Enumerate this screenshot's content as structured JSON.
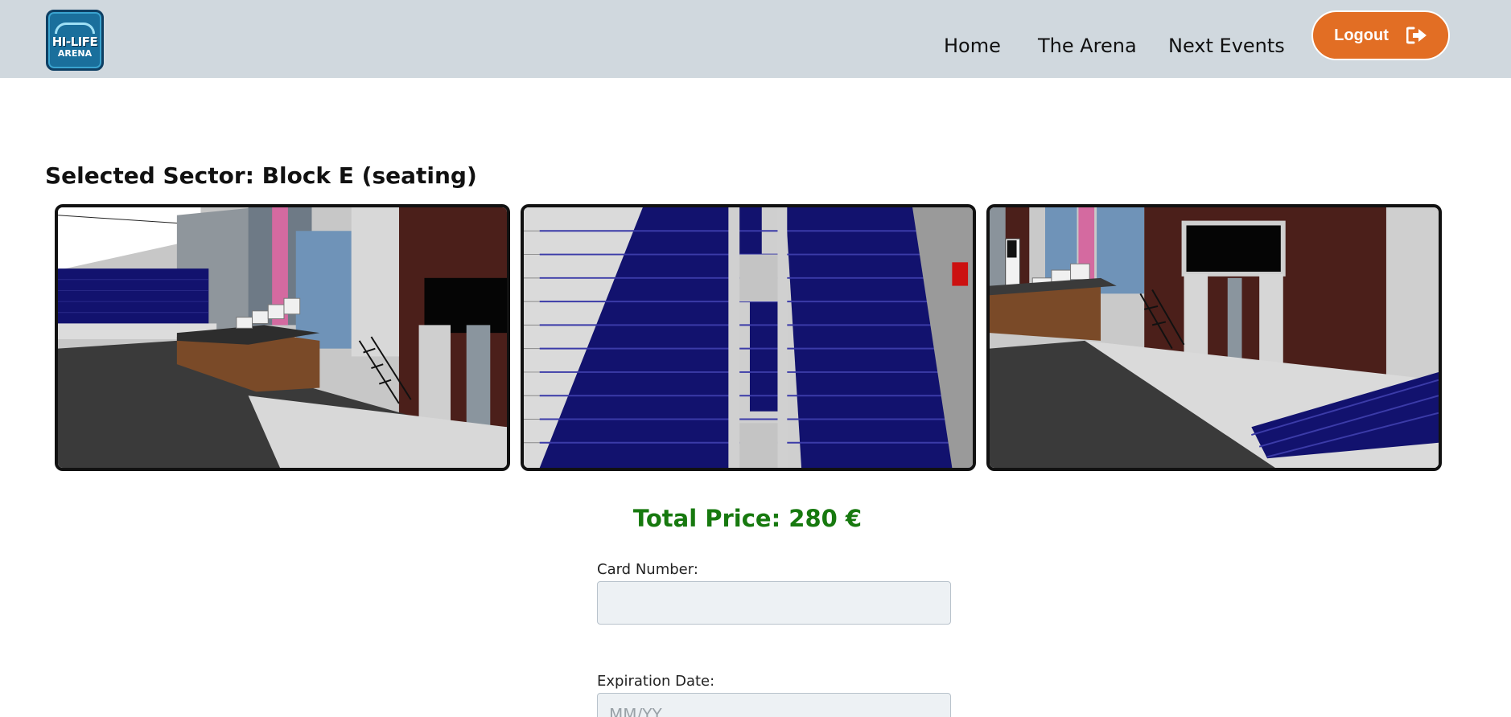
{
  "brand": {
    "logo_top": "HI-LIFE",
    "logo_bottom": "ARENA",
    "logo_icon": "arena-logo-icon"
  },
  "nav": {
    "items": [
      {
        "label": "Home"
      },
      {
        "label": "The Arena"
      },
      {
        "label": "Next Events"
      }
    ]
  },
  "logout": {
    "label": "Logout",
    "icon": "sign-out-icon"
  },
  "sector": {
    "title": "Selected Sector: Block E (seating)"
  },
  "photos": [
    {
      "subject": "stage-view-left"
    },
    {
      "subject": "seating-block-view"
    },
    {
      "subject": "stage-view-right"
    }
  ],
  "price": {
    "text": "Total Price: 280 €"
  },
  "form": {
    "card_label": "Card Number:",
    "card_value": "",
    "card_placeholder": "",
    "exp_label": "Expiration Date:",
    "exp_value": "",
    "exp_placeholder": "MM/YY"
  },
  "colors": {
    "navbar_bg": "#d0d8de",
    "accent": "#e26e24",
    "price_green": "#17790f",
    "seat_navy": "#12126e"
  }
}
